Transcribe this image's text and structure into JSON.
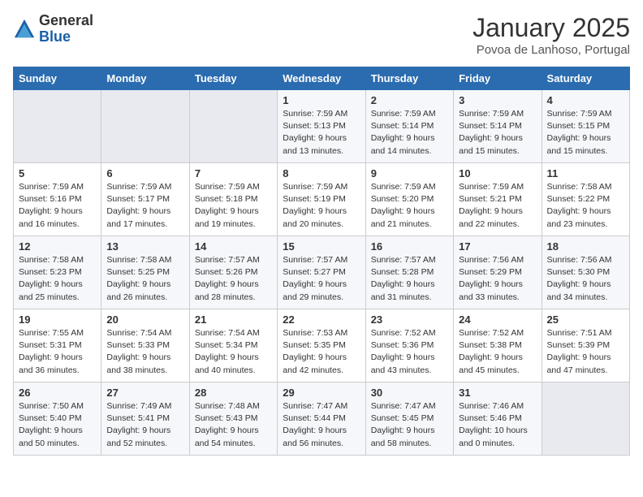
{
  "header": {
    "logo_general": "General",
    "logo_blue": "Blue",
    "month_title": "January 2025",
    "location": "Povoa de Lanhoso, Portugal"
  },
  "weekdays": [
    "Sunday",
    "Monday",
    "Tuesday",
    "Wednesday",
    "Thursday",
    "Friday",
    "Saturday"
  ],
  "weeks": [
    [
      {
        "day": "",
        "info": ""
      },
      {
        "day": "",
        "info": ""
      },
      {
        "day": "",
        "info": ""
      },
      {
        "day": "1",
        "info": "Sunrise: 7:59 AM\nSunset: 5:13 PM\nDaylight: 9 hours\nand 13 minutes."
      },
      {
        "day": "2",
        "info": "Sunrise: 7:59 AM\nSunset: 5:14 PM\nDaylight: 9 hours\nand 14 minutes."
      },
      {
        "day": "3",
        "info": "Sunrise: 7:59 AM\nSunset: 5:14 PM\nDaylight: 9 hours\nand 15 minutes."
      },
      {
        "day": "4",
        "info": "Sunrise: 7:59 AM\nSunset: 5:15 PM\nDaylight: 9 hours\nand 15 minutes."
      }
    ],
    [
      {
        "day": "5",
        "info": "Sunrise: 7:59 AM\nSunset: 5:16 PM\nDaylight: 9 hours\nand 16 minutes."
      },
      {
        "day": "6",
        "info": "Sunrise: 7:59 AM\nSunset: 5:17 PM\nDaylight: 9 hours\nand 17 minutes."
      },
      {
        "day": "7",
        "info": "Sunrise: 7:59 AM\nSunset: 5:18 PM\nDaylight: 9 hours\nand 19 minutes."
      },
      {
        "day": "8",
        "info": "Sunrise: 7:59 AM\nSunset: 5:19 PM\nDaylight: 9 hours\nand 20 minutes."
      },
      {
        "day": "9",
        "info": "Sunrise: 7:59 AM\nSunset: 5:20 PM\nDaylight: 9 hours\nand 21 minutes."
      },
      {
        "day": "10",
        "info": "Sunrise: 7:59 AM\nSunset: 5:21 PM\nDaylight: 9 hours\nand 22 minutes."
      },
      {
        "day": "11",
        "info": "Sunrise: 7:58 AM\nSunset: 5:22 PM\nDaylight: 9 hours\nand 23 minutes."
      }
    ],
    [
      {
        "day": "12",
        "info": "Sunrise: 7:58 AM\nSunset: 5:23 PM\nDaylight: 9 hours\nand 25 minutes."
      },
      {
        "day": "13",
        "info": "Sunrise: 7:58 AM\nSunset: 5:25 PM\nDaylight: 9 hours\nand 26 minutes."
      },
      {
        "day": "14",
        "info": "Sunrise: 7:57 AM\nSunset: 5:26 PM\nDaylight: 9 hours\nand 28 minutes."
      },
      {
        "day": "15",
        "info": "Sunrise: 7:57 AM\nSunset: 5:27 PM\nDaylight: 9 hours\nand 29 minutes."
      },
      {
        "day": "16",
        "info": "Sunrise: 7:57 AM\nSunset: 5:28 PM\nDaylight: 9 hours\nand 31 minutes."
      },
      {
        "day": "17",
        "info": "Sunrise: 7:56 AM\nSunset: 5:29 PM\nDaylight: 9 hours\nand 33 minutes."
      },
      {
        "day": "18",
        "info": "Sunrise: 7:56 AM\nSunset: 5:30 PM\nDaylight: 9 hours\nand 34 minutes."
      }
    ],
    [
      {
        "day": "19",
        "info": "Sunrise: 7:55 AM\nSunset: 5:31 PM\nDaylight: 9 hours\nand 36 minutes."
      },
      {
        "day": "20",
        "info": "Sunrise: 7:54 AM\nSunset: 5:33 PM\nDaylight: 9 hours\nand 38 minutes."
      },
      {
        "day": "21",
        "info": "Sunrise: 7:54 AM\nSunset: 5:34 PM\nDaylight: 9 hours\nand 40 minutes."
      },
      {
        "day": "22",
        "info": "Sunrise: 7:53 AM\nSunset: 5:35 PM\nDaylight: 9 hours\nand 42 minutes."
      },
      {
        "day": "23",
        "info": "Sunrise: 7:52 AM\nSunset: 5:36 PM\nDaylight: 9 hours\nand 43 minutes."
      },
      {
        "day": "24",
        "info": "Sunrise: 7:52 AM\nSunset: 5:38 PM\nDaylight: 9 hours\nand 45 minutes."
      },
      {
        "day": "25",
        "info": "Sunrise: 7:51 AM\nSunset: 5:39 PM\nDaylight: 9 hours\nand 47 minutes."
      }
    ],
    [
      {
        "day": "26",
        "info": "Sunrise: 7:50 AM\nSunset: 5:40 PM\nDaylight: 9 hours\nand 50 minutes."
      },
      {
        "day": "27",
        "info": "Sunrise: 7:49 AM\nSunset: 5:41 PM\nDaylight: 9 hours\nand 52 minutes."
      },
      {
        "day": "28",
        "info": "Sunrise: 7:48 AM\nSunset: 5:43 PM\nDaylight: 9 hours\nand 54 minutes."
      },
      {
        "day": "29",
        "info": "Sunrise: 7:47 AM\nSunset: 5:44 PM\nDaylight: 9 hours\nand 56 minutes."
      },
      {
        "day": "30",
        "info": "Sunrise: 7:47 AM\nSunset: 5:45 PM\nDaylight: 9 hours\nand 58 minutes."
      },
      {
        "day": "31",
        "info": "Sunrise: 7:46 AM\nSunset: 5:46 PM\nDaylight: 10 hours\nand 0 minutes."
      },
      {
        "day": "",
        "info": ""
      }
    ]
  ]
}
